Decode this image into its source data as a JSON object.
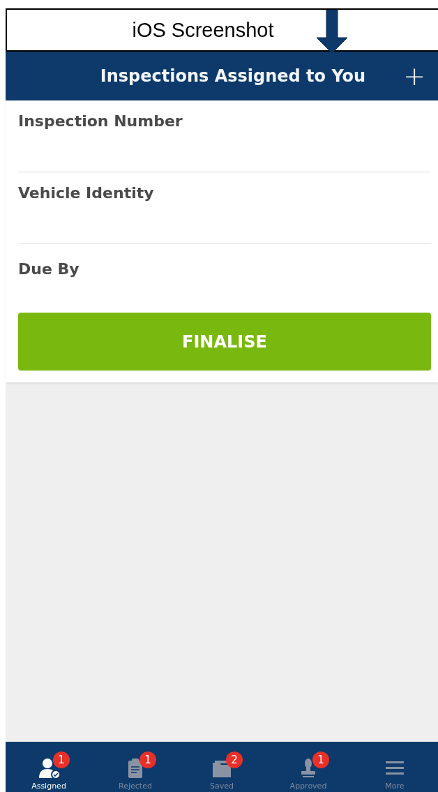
{
  "annotation": {
    "label": "iOS Screenshot"
  },
  "header": {
    "title": "Inspections Assigned to You",
    "add_button": "+"
  },
  "fields": [
    {
      "placeholder": "Inspection Number"
    },
    {
      "placeholder": "Vehicle Identity"
    },
    {
      "placeholder": "Due By"
    }
  ],
  "finalise_button": "FINALISE",
  "tabs": [
    {
      "label": "Assigned",
      "badge": "1",
      "selected": true,
      "kind": "person"
    },
    {
      "label": "Rejected",
      "badge": "1",
      "selected": false,
      "kind": "clipboard"
    },
    {
      "label": "Saved",
      "badge": "2",
      "selected": false,
      "kind": "folder"
    },
    {
      "label": "Approved",
      "badge": "1",
      "selected": false,
      "kind": "stamp"
    },
    {
      "label": "More",
      "selected": false,
      "kind": "menu"
    }
  ]
}
